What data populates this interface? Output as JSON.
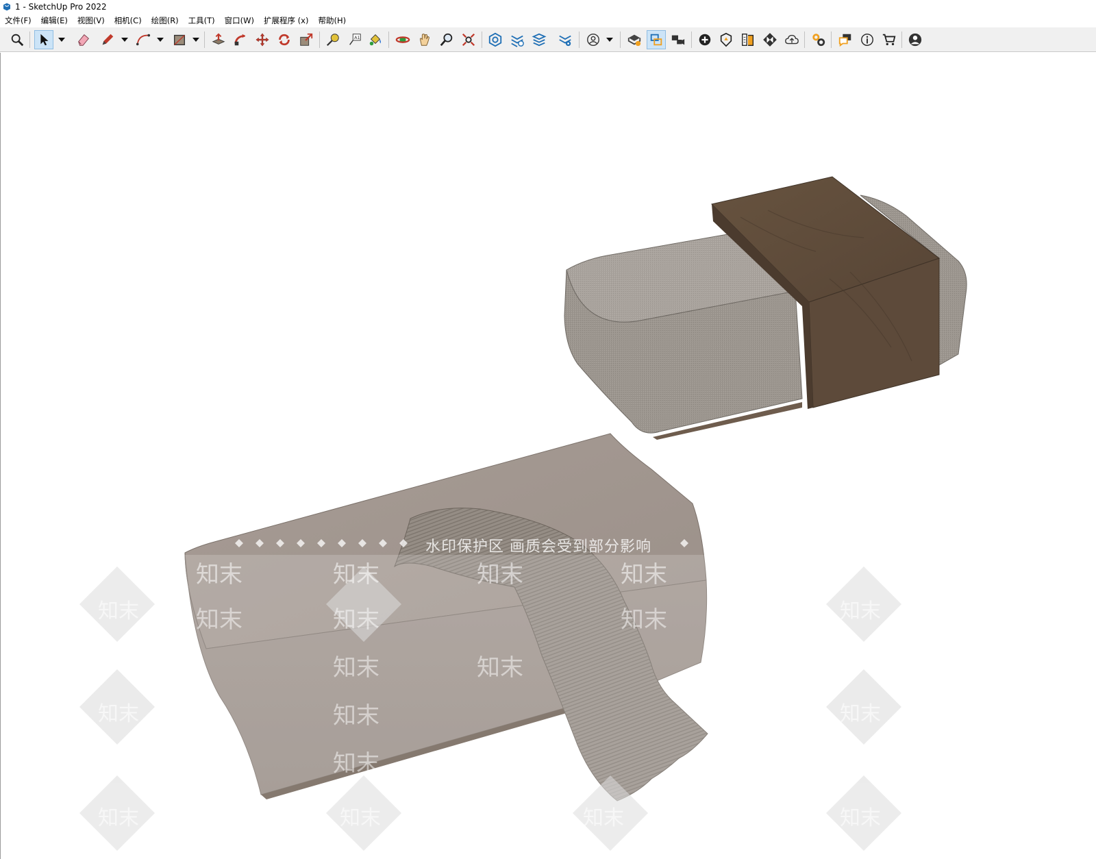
{
  "window": {
    "title": "1 - SketchUp Pro 2022"
  },
  "menu": {
    "items": [
      {
        "label": "文件(F)"
      },
      {
        "label": "编辑(E)"
      },
      {
        "label": "视图(V)"
      },
      {
        "label": "相机(C)"
      },
      {
        "label": "绘图(R)"
      },
      {
        "label": "工具(T)"
      },
      {
        "label": "窗口(W)"
      },
      {
        "label": "扩展程序 (x)"
      },
      {
        "label": "帮助(H)"
      }
    ]
  },
  "toolbar": {
    "active_tool": "select",
    "icons": [
      "zoom-window-icon",
      "select-arrow-icon",
      "eraser-icon",
      "pencil-line-icon",
      "arc-icon",
      "rectangle-icon",
      "push-pull-icon",
      "follow-me-icon",
      "move-icon",
      "rotate-icon",
      "scale-icon",
      "tape-measure-icon",
      "text-label-icon",
      "paint-bucket-icon",
      "orbit-icon",
      "pan-hand-icon",
      "zoom-icon",
      "zoom-extents-icon",
      "3d-warehouse-icon",
      "extension-warehouse-icon",
      "layout-icon",
      "extension-manager-icon",
      "user-profile-icon",
      "add-location-icon",
      "toggle-terrain-icon",
      "advanced-camera-icon",
      "add-icon",
      "solid-tools-icon",
      "sandbox-icon",
      "checker-icon",
      "cloud-upload-icon",
      "settings-gears-icon",
      "dialog-icon",
      "info-icon",
      "cart-icon",
      "account-icon"
    ]
  },
  "viewport": {
    "watermark_text": "知末",
    "watermark_notice": "水印保护区  画质会受到部分影响",
    "colors": {
      "fabric": "#a8a29c",
      "pillow": "#a29790",
      "wood": "#5e4b3c",
      "throw": "#928a82"
    }
  }
}
